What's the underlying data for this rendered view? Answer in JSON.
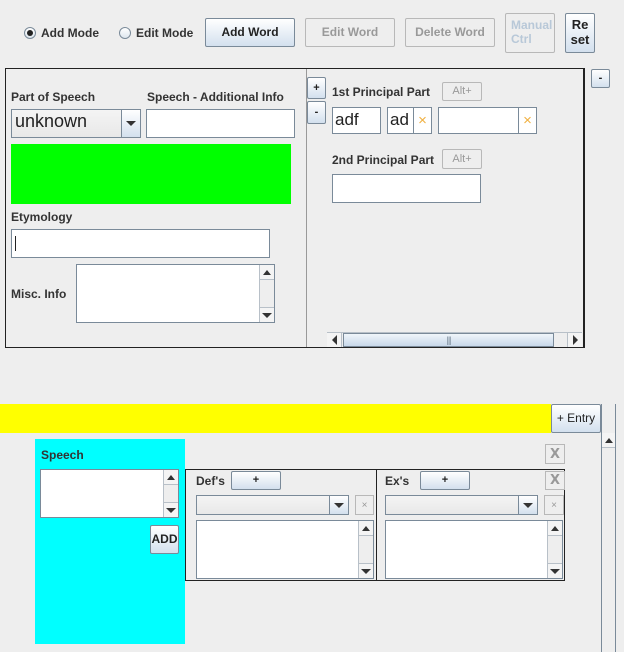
{
  "toolbar": {
    "mode_options": [
      {
        "label": "Add Mode",
        "selected": true
      },
      {
        "label": "Edit Mode",
        "selected": false
      }
    ],
    "add_word": "Add Word",
    "edit_word": "Edit Word",
    "delete_word": "Delete Word",
    "manual_ctrl_line1": "Manual",
    "manual_ctrl_line2": "Ctrl",
    "reset_line1": "Re",
    "reset_line2": "set"
  },
  "word_panel": {
    "part_of_speech_label": "Part of Speech",
    "part_of_speech_value": "unknown",
    "speech_additional_label": "Speech - Additional Info",
    "speech_additional_value": "",
    "status_color": "#00ff00",
    "etymology_label": "Etymology",
    "etymology_value": "",
    "misc_info_label": "Misc. Info",
    "misc_info_value": ""
  },
  "principal_parts": {
    "plus_label": "+",
    "minus_label": "-",
    "collapse_label": "-",
    "parts": [
      {
        "label": "1st Principal Part",
        "alt_label": "Alt+",
        "values": [
          "adf",
          "ad",
          ""
        ]
      },
      {
        "label": "2nd Principal Part",
        "alt_label": "Alt+",
        "values": [
          ""
        ]
      }
    ],
    "clear_icon": "×"
  },
  "entry_bar": {
    "color": "#ffff00",
    "add_entry_label": "+ Entry"
  },
  "entry": {
    "speech_panel_color": "#00ffff",
    "speech_label": "Speech",
    "speech_value": "",
    "add_label": "ADD",
    "remove_entry_label": "X",
    "defs": {
      "label": "Def's",
      "add_label": "+",
      "remove_label": "X",
      "small_remove": "×",
      "selected": "",
      "text": ""
    },
    "examples": {
      "label": "Ex's",
      "add_label": "+",
      "remove_label": "X",
      "small_remove": "×",
      "selected": "",
      "text": ""
    }
  }
}
